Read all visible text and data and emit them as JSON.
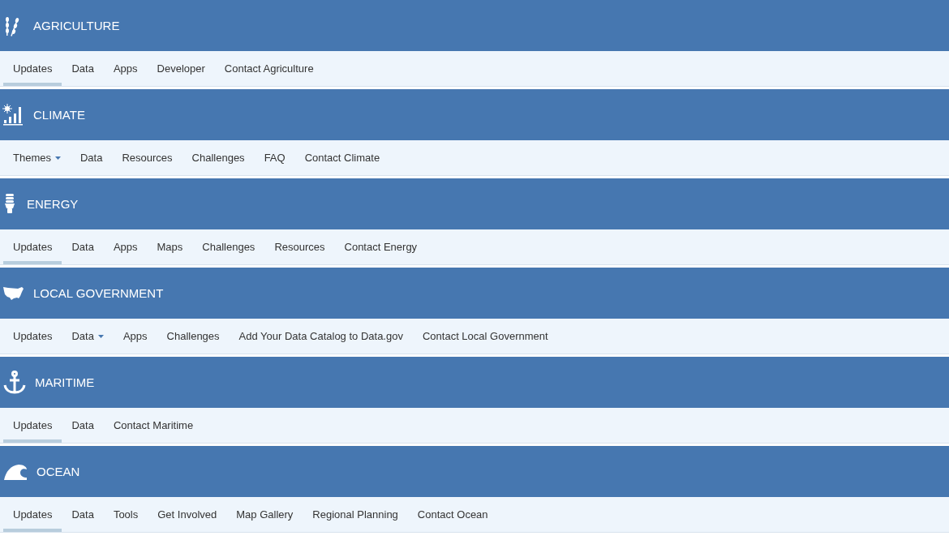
{
  "sections": [
    {
      "title": "AGRICULTURE",
      "kind": "wheat",
      "tabs": [
        {
          "label": "Updates",
          "selected": true,
          "kind": "link"
        },
        {
          "label": "Data",
          "selected": false,
          "kind": "link"
        },
        {
          "label": "Apps",
          "selected": false,
          "kind": "link"
        },
        {
          "label": "Developer",
          "selected": false,
          "kind": "link"
        },
        {
          "label": "Contact Agriculture",
          "selected": false,
          "kind": "link"
        }
      ]
    },
    {
      "title": "CLIMATE",
      "kind": "chart",
      "tabs": [
        {
          "label": "Themes",
          "selected": false,
          "kind": "dropdown"
        },
        {
          "label": "Data",
          "selected": false,
          "kind": "link"
        },
        {
          "label": "Resources",
          "selected": false,
          "kind": "link"
        },
        {
          "label": "Challenges",
          "selected": false,
          "kind": "link"
        },
        {
          "label": "FAQ",
          "selected": false,
          "kind": "link"
        },
        {
          "label": "Contact Climate",
          "selected": false,
          "kind": "link"
        }
      ]
    },
    {
      "title": "ENERGY",
      "kind": "bulb",
      "tabs": [
        {
          "label": "Updates",
          "selected": true,
          "kind": "link"
        },
        {
          "label": "Data",
          "selected": false,
          "kind": "link"
        },
        {
          "label": "Apps",
          "selected": false,
          "kind": "link"
        },
        {
          "label": "Maps",
          "selected": false,
          "kind": "link"
        },
        {
          "label": "Challenges",
          "selected": false,
          "kind": "link"
        },
        {
          "label": "Resources",
          "selected": false,
          "kind": "link"
        },
        {
          "label": "Contact Energy",
          "selected": false,
          "kind": "link"
        }
      ]
    },
    {
      "title": "LOCAL GOVERNMENT",
      "kind": "map",
      "tabs": [
        {
          "label": "Updates",
          "selected": false,
          "kind": "link"
        },
        {
          "label": "Data",
          "selected": false,
          "kind": "dropdown"
        },
        {
          "label": "Apps",
          "selected": false,
          "kind": "link"
        },
        {
          "label": "Challenges",
          "selected": false,
          "kind": "link"
        },
        {
          "label": "Add Your Data Catalog to Data.gov",
          "selected": false,
          "kind": "link"
        },
        {
          "label": "Contact Local Government",
          "selected": false,
          "kind": "link"
        }
      ]
    },
    {
      "title": "MARITIME",
      "kind": "anchor",
      "tabs": [
        {
          "label": "Updates",
          "selected": true,
          "kind": "link"
        },
        {
          "label": "Data",
          "selected": false,
          "kind": "link"
        },
        {
          "label": "Contact Maritime",
          "selected": false,
          "kind": "link"
        }
      ]
    },
    {
      "title": "OCEAN",
      "kind": "wave",
      "tabs": [
        {
          "label": "Updates",
          "selected": true,
          "kind": "link"
        },
        {
          "label": "Data",
          "selected": false,
          "kind": "link"
        },
        {
          "label": "Tools",
          "selected": false,
          "kind": "link"
        },
        {
          "label": "Get Involved",
          "selected": false,
          "kind": "link"
        },
        {
          "label": "Map Gallery",
          "selected": false,
          "kind": "link"
        },
        {
          "label": "Regional Planning",
          "selected": false,
          "kind": "link"
        },
        {
          "label": "Contact Ocean",
          "selected": false,
          "kind": "link"
        }
      ]
    }
  ]
}
